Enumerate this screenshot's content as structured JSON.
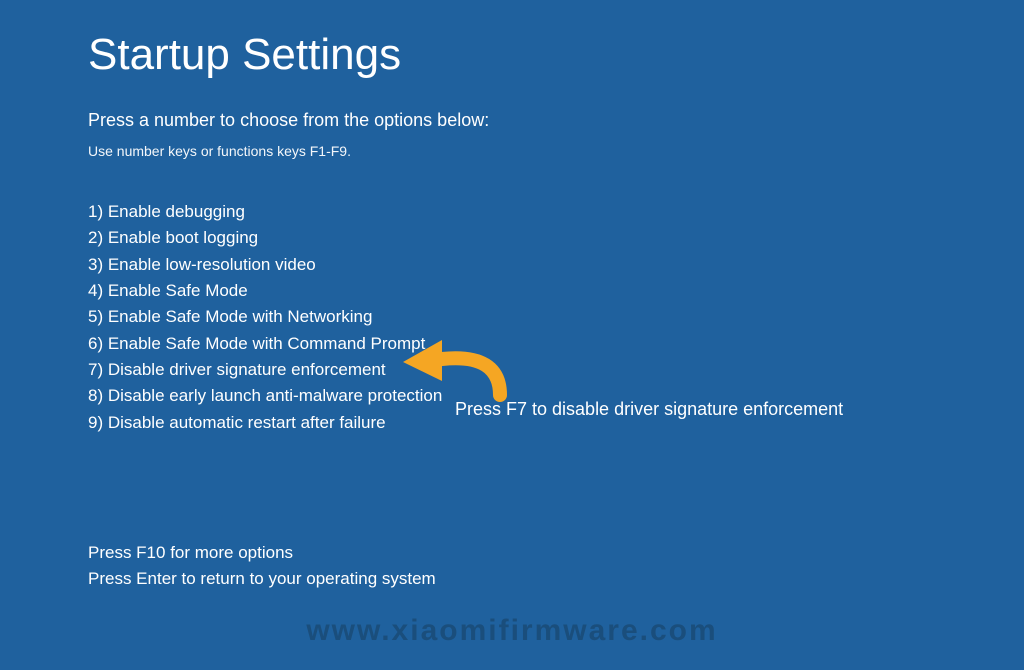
{
  "title": "Startup Settings",
  "subtitle": "Press a number to choose from the options below:",
  "hint": "Use number keys or functions keys F1-F9.",
  "options": {
    "o1": "1) Enable debugging",
    "o2": "2) Enable boot logging",
    "o3": "3) Enable low-resolution video",
    "o4": "4) Enable Safe Mode",
    "o5": "5) Enable Safe Mode with Networking",
    "o6": "6) Enable Safe Mode with Command Prompt",
    "o7": "7) Disable driver signature enforcement",
    "o8": "8) Disable early launch anti-malware protection",
    "o9": "9) Disable automatic restart after failure"
  },
  "footer": {
    "line1": "Press F10 for more options",
    "line2": "Press Enter to return to your operating system"
  },
  "callout": "Press F7 to disable driver signature enforcement",
  "watermark": "www.xiaomifirmware.com",
  "colors": {
    "background": "#1f619e",
    "text": "#ffffff",
    "arrow": "#f5a623",
    "watermark": "#1a4b77"
  }
}
